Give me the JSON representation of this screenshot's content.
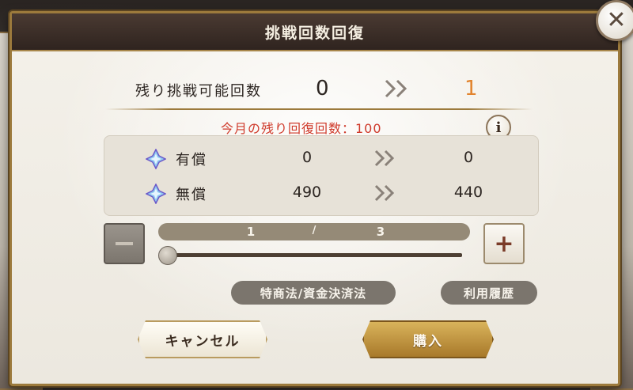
{
  "dialog": {
    "title": "挑戦回数回復",
    "close_label": "✕"
  },
  "remaining": {
    "label": "残り挑戦可能回数",
    "from": "0",
    "to": "1",
    "to_color": "#e2842e"
  },
  "monthly_recovery": "今月の残り回復回数：100",
  "info_label": "i",
  "currency": [
    {
      "name": "有償",
      "from": "0",
      "to": "0",
      "icon": "crystal-icon"
    },
    {
      "name": "無償",
      "from": "490",
      "to": "440",
      "icon": "crystal-icon"
    }
  ],
  "stepper": {
    "current": "1",
    "separator": "/",
    "max": "3",
    "plus_label": "+",
    "slider_value_fraction": 0
  },
  "links": {
    "law": "特商法/資金決済法",
    "history": "利用履歴"
  },
  "buttons": {
    "cancel": "キャンセル",
    "buy": "購入"
  }
}
